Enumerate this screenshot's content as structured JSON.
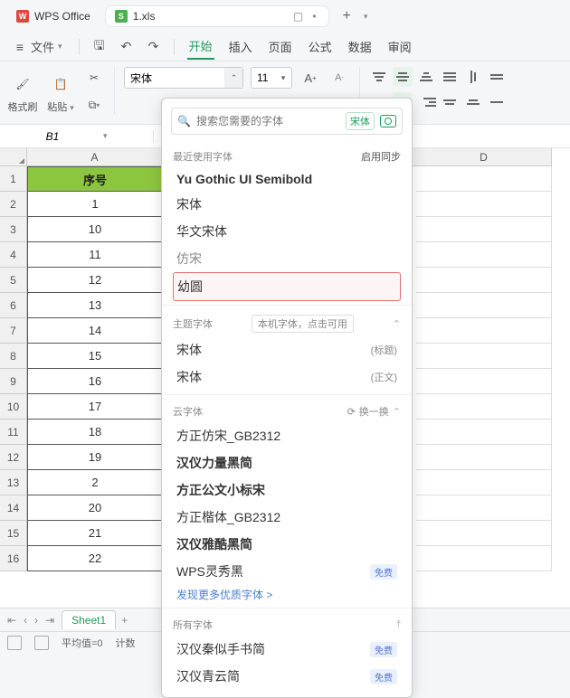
{
  "titlebar": {
    "app_name": "WPS Office",
    "file_name": "1.xls"
  },
  "menubar": {
    "file_menu": "文件",
    "tabs": [
      "开始",
      "插入",
      "页面",
      "公式",
      "数据",
      "审阅"
    ]
  },
  "ribbon": {
    "format_brush": "格式刷",
    "paste": "粘贴",
    "font_name": "宋体",
    "font_size": "11",
    "font_increase": "A⁺",
    "font_decrease": "A⁻"
  },
  "namebox": {
    "cell_ref": "B1"
  },
  "columns": [
    "A",
    "D"
  ],
  "colA_header": "序号",
  "colA_data": [
    "1",
    "10",
    "11",
    "12",
    "13",
    "14",
    "15",
    "16",
    "17",
    "18",
    "19",
    "2",
    "20",
    "21",
    "22"
  ],
  "fontpanel": {
    "search_placeholder": "搜索您需要的字体",
    "search_tag": "宋体",
    "recent_head": "最近使用字体",
    "sync_label": "启用同步",
    "recent_fonts": [
      "Yu Gothic UI Semibold",
      "宋体",
      "华文宋体",
      "仿宋",
      "幼圆"
    ],
    "theme_head": "主题字体",
    "theme_sub": "本机字体，点击可用",
    "theme_fonts": [
      {
        "name": "宋体",
        "role": "(标题)"
      },
      {
        "name": "宋体",
        "role": "(正文)"
      }
    ],
    "cloud_head": "云字体",
    "refresh": "换一换",
    "cloud_fonts": [
      {
        "name": "方正仿宋_GB2312",
        "bold": false,
        "badge": ""
      },
      {
        "name": "汉仪力量黑简",
        "bold": true,
        "badge": ""
      },
      {
        "name": "方正公文小标宋",
        "bold": true,
        "badge": ""
      },
      {
        "name": "方正楷体_GB2312",
        "bold": false,
        "badge": ""
      },
      {
        "name": "汉仪雅酷黑简",
        "bold": true,
        "badge": ""
      },
      {
        "name": "WPS灵秀黑",
        "bold": false,
        "badge": "免费"
      }
    ],
    "more_fonts": "发现更多优质字体 >",
    "all_head": "所有字体",
    "all_fonts": [
      {
        "name": "汉仪秦似手书简",
        "badge": "免费"
      },
      {
        "name": "汉仪青云简",
        "badge": "免费"
      }
    ]
  },
  "sheetbar": {
    "sheet_name": "Sheet1"
  },
  "statusbar": {
    "avg": "平均值=0",
    "count": "计数"
  }
}
